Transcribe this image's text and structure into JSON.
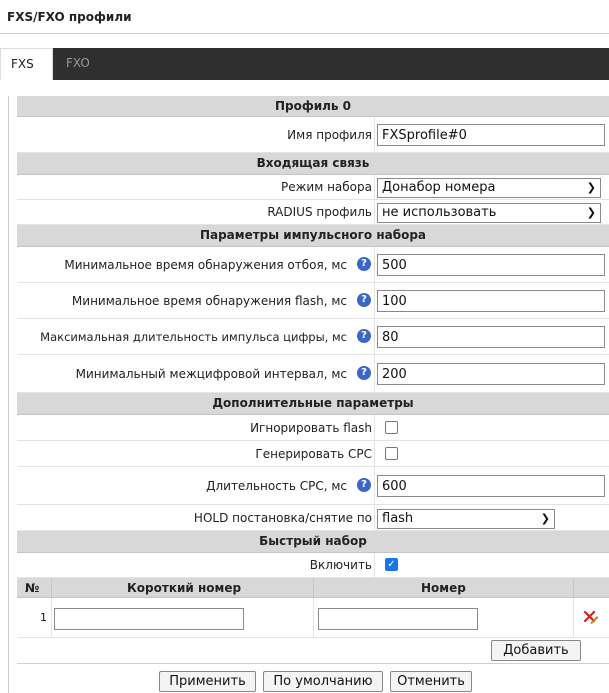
{
  "title": "FXS/FXO профили",
  "tabs": [
    {
      "label": "FXS",
      "active": true
    },
    {
      "label": "FXO",
      "active": false
    }
  ],
  "profile": {
    "header": "Профиль 0",
    "name_label": "Имя профиля",
    "name_value": "FXSprofile#0"
  },
  "incoming": {
    "header": "Входящая связь",
    "dial_mode_label": "Режим набора",
    "dial_mode_value": "Донабор номера",
    "radius_label": "RADIUS профиль",
    "radius_value": "не использовать"
  },
  "pulse": {
    "header": "Параметры импульсного набора",
    "hangup_label": "Минимальное время обнаружения отбоя, мс",
    "hangup_value": "500",
    "flash_label": "Минимальное время обнаружения flash, мс",
    "flash_value": "100",
    "digit_label": "Максимальная длительность импульса цифры, мс",
    "digit_value": "80",
    "interdigit_label": "Минимальный межцифровой интервал, мс",
    "interdigit_value": "200"
  },
  "additional": {
    "header": "Дополнительные параметры",
    "ignore_flash_label": "Игнорировать flash",
    "ignore_flash_checked": false,
    "gen_cpc_label": "Генерировать CPC",
    "gen_cpc_checked": false,
    "cpc_duration_label": "Длительность CPC, мс",
    "cpc_duration_value": "600",
    "hold_label": "HOLD постановка/снятие по",
    "hold_value": "flash"
  },
  "speed_dial": {
    "header": "Быстрый набор",
    "enable_label": "Включить",
    "enable_checked": true,
    "col_num": "№",
    "col_short": "Короткий номер",
    "col_number": "Номер",
    "rows": [
      {
        "index": "1",
        "short": "",
        "number": ""
      }
    ],
    "add_label": "Добавить"
  },
  "buttons": {
    "apply": "Применить",
    "defaults": "По умолчанию",
    "cancel": "Отменить"
  },
  "icons": {
    "hint": "question-circle-icon",
    "delete": "delete-row-icon"
  }
}
